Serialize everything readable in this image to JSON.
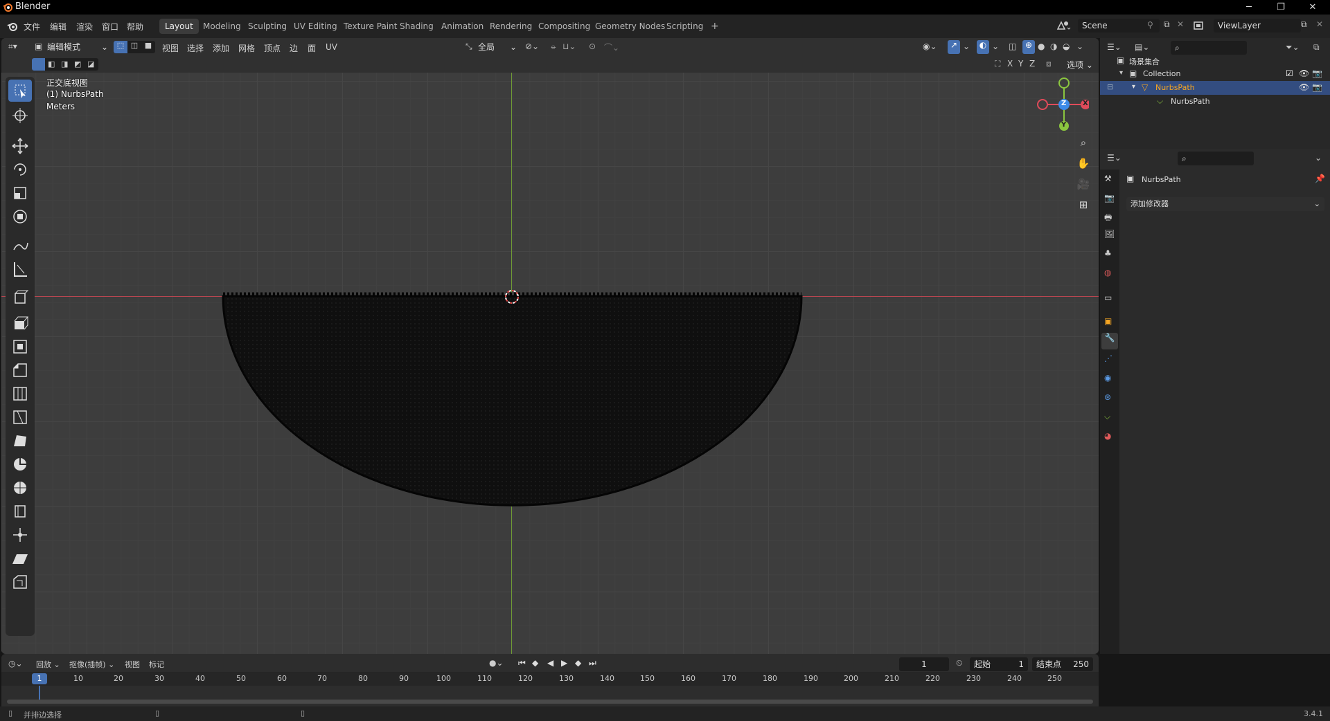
{
  "window": {
    "title": "Blender",
    "controls": [
      "─",
      "❐",
      "✕"
    ]
  },
  "menus": [
    "文件",
    "编辑",
    "渲染",
    "窗口",
    "帮助"
  ],
  "workspaces": [
    "Layout",
    "Modeling",
    "Sculpting",
    "UV Editing",
    "Texture Paint",
    "Shading",
    "Animation",
    "Rendering",
    "Compositing",
    "Geometry Nodes",
    "Scripting"
  ],
  "active_workspace": "Layout",
  "add_workspace": "+",
  "scene": {
    "name": "Scene"
  },
  "view_layer": {
    "name": "ViewLayer"
  },
  "viewport": {
    "mode": "编辑模式",
    "menus": [
      "视图",
      "选择",
      "添加",
      "网格",
      "顶点",
      "边",
      "面",
      "UV"
    ],
    "transform_orientation": "全局",
    "view_name": "正交底视图",
    "object_info": "(1) NurbsPath",
    "units": "Meters",
    "options_label": "选项",
    "axis_toggles": [
      "X",
      "Y",
      "Z"
    ],
    "gizmo": {
      "x": "X",
      "y": "Y",
      "z": "Z"
    }
  },
  "outliner": {
    "root": "场景集合",
    "collection": "Collection",
    "object": "NurbsPath",
    "data": "NurbsPath"
  },
  "properties": {
    "object_name": "NurbsPath",
    "add_modifier": "添加修改器"
  },
  "timeline": {
    "menus": [
      "回放",
      "抠像(插帧)",
      "视图",
      "标记"
    ],
    "current_frame": "1",
    "start_label": "起始",
    "start": "1",
    "end_label": "结束点",
    "end": "250",
    "ticks": [
      "10",
      "20",
      "30",
      "40",
      "50",
      "60",
      "70",
      "80",
      "90",
      "100",
      "110",
      "120",
      "130",
      "140",
      "150",
      "160",
      "170",
      "180",
      "190",
      "200",
      "210",
      "220",
      "230",
      "240",
      "250"
    ],
    "playhead": "1"
  },
  "status": {
    "hint": "并排边选择",
    "version": "3.4.1"
  },
  "colors": {
    "accent": "#4772b3",
    "x_axis": "#e04b5a",
    "y_axis": "#8bc63f",
    "z_axis": "#3d8be8",
    "selected_object": "#f5a623"
  }
}
